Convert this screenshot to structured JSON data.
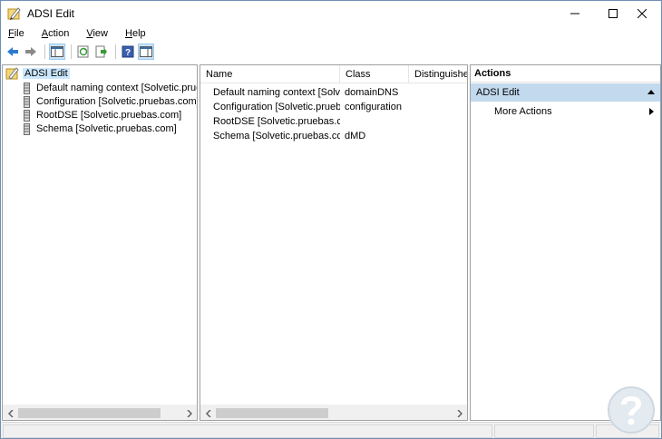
{
  "window": {
    "title": "ADSI Edit",
    "controls": [
      "minimize",
      "maximize",
      "close"
    ]
  },
  "menu": [
    "File",
    "Action",
    "View",
    "Help"
  ],
  "toolbar": {
    "buttons": [
      "back-icon",
      "forward-icon",
      "show-hide-console-tree-icon",
      "refresh-icon",
      "export-list-icon",
      "help-icon",
      "show-hide-action-pane-icon"
    ]
  },
  "tree": {
    "root": "ADSI Edit",
    "items": [
      "Default naming context [Solvetic.pruebas.com]",
      "Configuration [Solvetic.pruebas.com]",
      "RootDSE [Solvetic.pruebas.com]",
      "Schema [Solvetic.pruebas.com]"
    ]
  },
  "list": {
    "columns": [
      "Name",
      "Class",
      "Distinguished Name"
    ],
    "rows": [
      {
        "name": "Default naming context [Solvetic.pruebas.com]",
        "class": "domainDNS"
      },
      {
        "name": "Configuration [Solvetic.pruebas.com]",
        "class": "configuration"
      },
      {
        "name": "RootDSE [Solvetic.pruebas.com]",
        "class": ""
      },
      {
        "name": "Schema [Solvetic.pruebas.com]",
        "class": "dMD"
      }
    ]
  },
  "actions": {
    "header": "Actions",
    "section": "ADSI Edit",
    "items": [
      "More Actions"
    ]
  },
  "colors": {
    "selection": "#cce8ff",
    "actions_section": "#c2d9ee",
    "toolbar_blue_arrow": "#2d7bd3",
    "toolbar_green": "#3a9a3a"
  }
}
